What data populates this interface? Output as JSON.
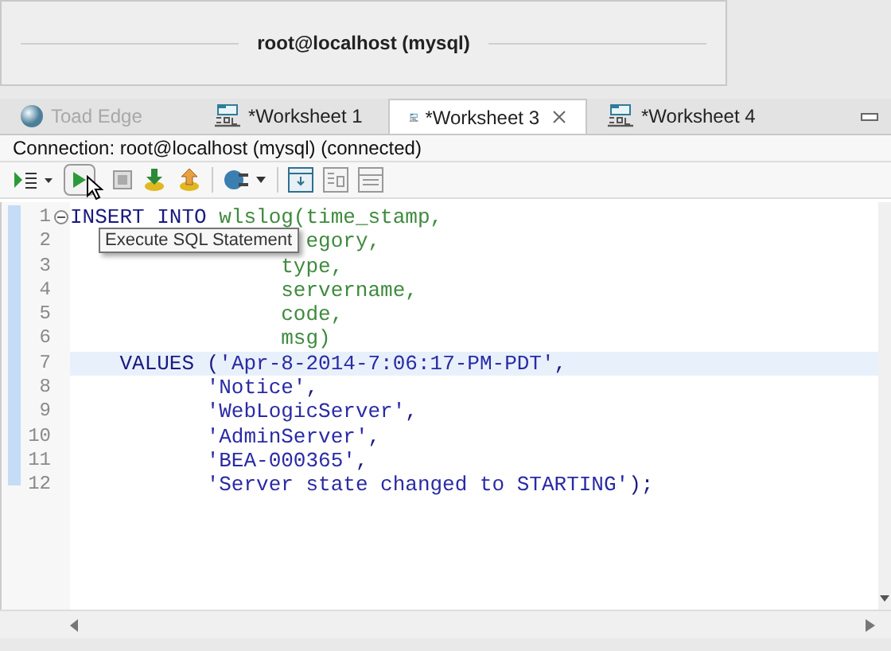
{
  "window": {
    "title": "root@localhost (mysql)"
  },
  "tabs": [
    {
      "label": "Toad Edge",
      "kind": "home",
      "selected": false,
      "disabled": true
    },
    {
      "label": "*Worksheet 1",
      "kind": "sql",
      "selected": false,
      "disabled": false
    },
    {
      "label": "*Worksheet 3",
      "kind": "sql",
      "selected": true,
      "disabled": false
    },
    {
      "label": "*Worksheet 4",
      "kind": "sql",
      "selected": false,
      "disabled": false
    }
  ],
  "connection": "Connection: root@localhost (mysql) (connected)",
  "tooltip": "Execute SQL Statement",
  "lines": [
    {
      "number": "1",
      "current": false,
      "tokens": [
        {
          "kind": "keyword",
          "text": "INSERT INTO "
        },
        {
          "kind": "identifier",
          "text": "wlslog(time_stamp,"
        }
      ]
    },
    {
      "number": "2",
      "current": false,
      "tokens": [
        {
          "kind": "identifier",
          "text": "                   egory,"
        }
      ]
    },
    {
      "number": "3",
      "current": false,
      "tokens": [
        {
          "kind": "identifier",
          "text": "                 type,"
        }
      ]
    },
    {
      "number": "4",
      "current": false,
      "tokens": [
        {
          "kind": "identifier",
          "text": "                 servername,"
        }
      ]
    },
    {
      "number": "5",
      "current": false,
      "tokens": [
        {
          "kind": "identifier",
          "text": "                 code,"
        }
      ]
    },
    {
      "number": "6",
      "current": false,
      "tokens": [
        {
          "kind": "identifier",
          "text": "                 msg)"
        }
      ]
    },
    {
      "number": "7",
      "current": true,
      "tokens": [
        {
          "kind": "keyword",
          "text": "    VALUES ("
        },
        {
          "kind": "string",
          "text": "'Apr-8-2014-7:06:17-PM-PDT'"
        },
        {
          "kind": "keyword",
          "text": ","
        }
      ]
    },
    {
      "number": "8",
      "current": false,
      "tokens": [
        {
          "kind": "string",
          "text": "           'Notice'"
        },
        {
          "kind": "keyword",
          "text": ","
        }
      ]
    },
    {
      "number": "9",
      "current": false,
      "tokens": [
        {
          "kind": "string",
          "text": "           'WebLogicServer'"
        },
        {
          "kind": "keyword",
          "text": ","
        }
      ]
    },
    {
      "number": "10",
      "current": false,
      "tokens": [
        {
          "kind": "string",
          "text": "           'AdminServer'"
        },
        {
          "kind": "keyword",
          "text": ","
        }
      ]
    },
    {
      "number": "11",
      "current": false,
      "tokens": [
        {
          "kind": "string",
          "text": "           'BEA-000365'"
        },
        {
          "kind": "keyword",
          "text": ","
        }
      ]
    },
    {
      "number": "12",
      "current": false,
      "tokens": [
        {
          "kind": "string",
          "text": "           'Server state changed to STARTING'"
        },
        {
          "kind": "keyword",
          "text": ");"
        }
      ]
    }
  ]
}
